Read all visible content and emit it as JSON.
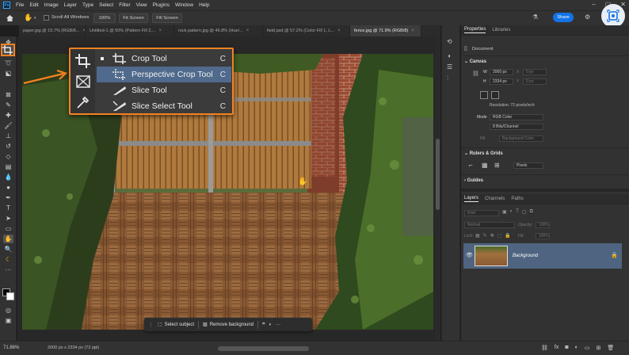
{
  "menu": {
    "logo": "Ps",
    "items": [
      "File",
      "Edit",
      "Image",
      "Layer",
      "Type",
      "Select",
      "Filter",
      "View",
      "Plugins",
      "Window",
      "Help"
    ]
  },
  "options": {
    "scroll_all": "Scroll All Windows",
    "zoom100": "100%",
    "fit_screen": "Fit Screen",
    "fill_screen": "Fill Screen",
    "share": "Share"
  },
  "tabs": [
    {
      "label": "paper.jpg @ 15.7% (RGB/8...",
      "active": false
    },
    {
      "label": "Untitled-1 @ 50% (Pattern Fill 2,...",
      "active": false
    },
    {
      "label": "rock pattern.jpg @ 46.8% (Hue/...",
      "active": false
    },
    {
      "label": "field.psd @ 57.2% (Color Fill 1, L...",
      "active": false
    },
    {
      "label": "fence.jpg @ 71.9% (RGB/8)",
      "active": true
    }
  ],
  "flyout": {
    "items": [
      {
        "label": "Crop Tool",
        "shortcut": "C",
        "icon": "crop-icon",
        "selected": true,
        "highlighted": false
      },
      {
        "label": "Perspective Crop Tool",
        "shortcut": "C",
        "icon": "perspective-crop-icon",
        "selected": false,
        "highlighted": true
      },
      {
        "label": "Slice Tool",
        "shortcut": "C",
        "icon": "slice-icon",
        "selected": false,
        "highlighted": false
      },
      {
        "label": "Slice Select Tool",
        "shortcut": "C",
        "icon": "slice-select-icon",
        "selected": false,
        "highlighted": false
      }
    ]
  },
  "context_bar": {
    "select_subject": "Select subject",
    "remove_background": "Remove background",
    "more": "···"
  },
  "properties": {
    "tabs": [
      "Properties",
      "Libraries"
    ],
    "document_label": "Document",
    "canvas_title": "Canvas",
    "width_label": "W",
    "width_value": "2000 px",
    "height_label": "H",
    "height_value": "2334 px",
    "x_label": "X",
    "x_value": "0 px",
    "y_label": "Y",
    "y_value": "0 px",
    "resolution": "Resolution: 72 pixels/inch",
    "mode_label": "Mode",
    "mode_value": "RGB Color",
    "bits_value": "8 Bits/Channel",
    "fill_label": "Fill",
    "fill_value": "Background Color",
    "rulers_title": "Rulers & Grids",
    "units_value": "Pixels",
    "guides_title": "Guides"
  },
  "layers": {
    "tabs": [
      "Layers",
      "Channels",
      "Paths"
    ],
    "kind_placeholder": "Kind",
    "blend_mode": "Normal",
    "opacity_label": "Opacity:",
    "opacity_value": "100%",
    "lock_label": "Lock:",
    "fill_label": "Fill:",
    "fill_value": "100%",
    "layer_name": "Background"
  },
  "status": {
    "zoom": "71.86%",
    "doc_size": "2000 px x 2334 px (72 ppi)"
  },
  "colors": {
    "accent_orange": "#f58220",
    "highlight_blue": "#4f6a8c",
    "share_blue": "#1473e6"
  }
}
